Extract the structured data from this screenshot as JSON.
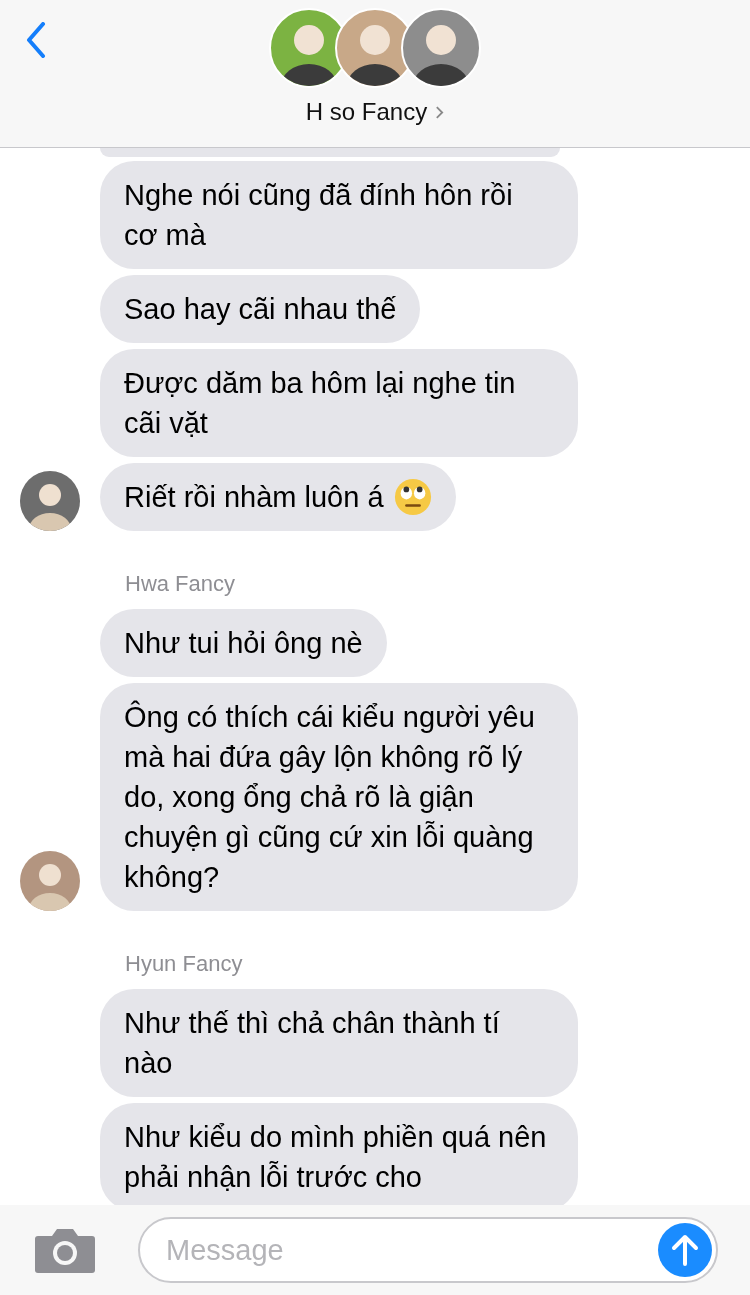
{
  "header": {
    "title": "H so Fancy",
    "avatars": [
      {
        "color": "#7cb342"
      },
      {
        "color": "#c8a888"
      },
      {
        "color": "#8d8d8d"
      }
    ]
  },
  "groups": [
    {
      "avatar": {
        "color": "#6d6d6d"
      },
      "messages": [
        {
          "text": "Nghe nói cũng đã đính hôn rồi cơ mà"
        },
        {
          "text": "Sao hay cãi nhau thế"
        },
        {
          "text": "Được dăm ba hôm lại nghe tin cãi vặt"
        },
        {
          "text": "Riết rồi nhàm luôn á",
          "kind": "emoji"
        }
      ]
    },
    {
      "sender": "Hwa Fancy",
      "avatar": {
        "color": "#b39580"
      },
      "messages": [
        {
          "text": "Như tui hỏi ông nè"
        },
        {
          "text": "Ông có thích cái kiểu người yêu mà hai đứa gây lộn không rõ lý do, xong ổng chả rõ là giận chuyện gì cũng cứ xin lỗi quàng không?"
        }
      ]
    },
    {
      "sender": "Hyun Fancy",
      "messages": [
        {
          "text": "Như thế thì chả chân thành tí nào"
        },
        {
          "text": "Như kiểu do mình phiền quá nên phải nhận lỗi trước cho"
        }
      ]
    }
  ],
  "composer": {
    "placeholder": "Message"
  }
}
